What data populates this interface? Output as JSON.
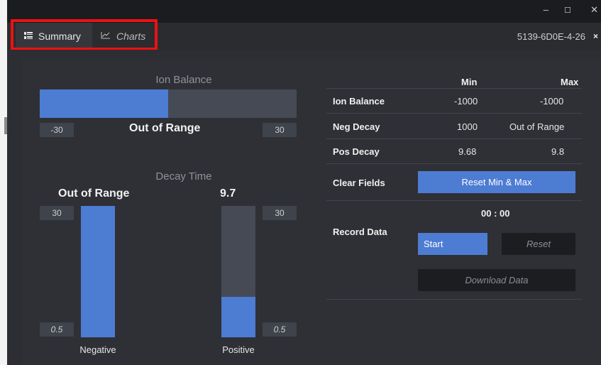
{
  "window": {
    "minimize": "–",
    "maximize": "☐",
    "close": "✕"
  },
  "tabs": [
    {
      "label": "Summary",
      "icon": "grid-icon",
      "active": true
    },
    {
      "label": "Charts",
      "icon": "line-chart-icon",
      "active": false
    }
  ],
  "device_id": "5139-6D0E-4-26",
  "tab_close": "×",
  "ion_balance": {
    "title": "Ion Balance",
    "min_label": "-30",
    "max_label": "30",
    "status": "Out of Range",
    "fill_fraction": 0.5
  },
  "decay_time": {
    "title": "Decay Time",
    "negative": {
      "value": "Out of Range",
      "top_label": "30",
      "bottom_label": "0.5",
      "label": "Negative",
      "fill_fraction": 1.0
    },
    "positive": {
      "value": "9.7",
      "top_label": "30",
      "bottom_label": "0.5",
      "label": "Positive",
      "fill_fraction": 0.31
    }
  },
  "table": {
    "col_min": "Min",
    "col_max": "Max",
    "rows": [
      {
        "label": "Ion Balance",
        "min": "-1000",
        "max": "-1000"
      },
      {
        "label": "Neg Decay",
        "min": "1000",
        "max": "Out of Range"
      },
      {
        "label": "Pos Decay",
        "min": "9.68",
        "max": "9.8"
      }
    ]
  },
  "clear_fields": {
    "label": "Clear Fields",
    "button": "Reset Min & Max"
  },
  "record": {
    "label": "Record Data",
    "timer": "00 : 00",
    "start": "Start",
    "reset": "Reset",
    "download": "Download Data"
  },
  "colors": {
    "accent": "#4d7cd3",
    "panel": "#2e3035",
    "track": "#454a54",
    "highlight": "#ee1111"
  }
}
